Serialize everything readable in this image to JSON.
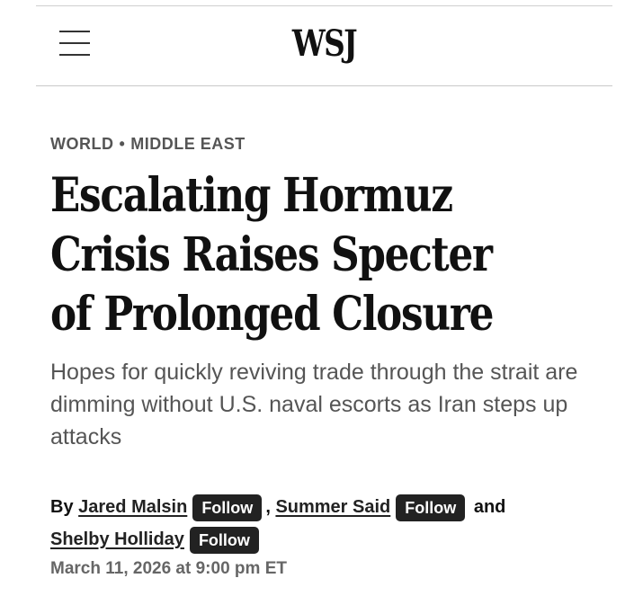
{
  "header": {
    "logo": "WSJ",
    "menu_icon": "hamburger-menu-icon"
  },
  "article": {
    "kicker": {
      "section": "WORLD",
      "separator": "•",
      "subsection": "MIDDLE EAST"
    },
    "headline": "Escalating Hormuz Crisis Raises Specter of Prolonged Closure",
    "dek": "Hopes for quickly reviving trade through the strait are dimming without U.S. naval escorts as Iran steps up attacks",
    "byline": {
      "prefix": "By",
      "authors": [
        {
          "name": "Jared Malsin",
          "follow_label": "Follow"
        },
        {
          "name": "Summer Said",
          "follow_label": "Follow"
        },
        {
          "name": "Shelby Holliday",
          "follow_label": "Follow"
        }
      ],
      "comma": ",",
      "conjunction": "and"
    },
    "date": "March 11, 2026 at 9:00 pm ET"
  }
}
